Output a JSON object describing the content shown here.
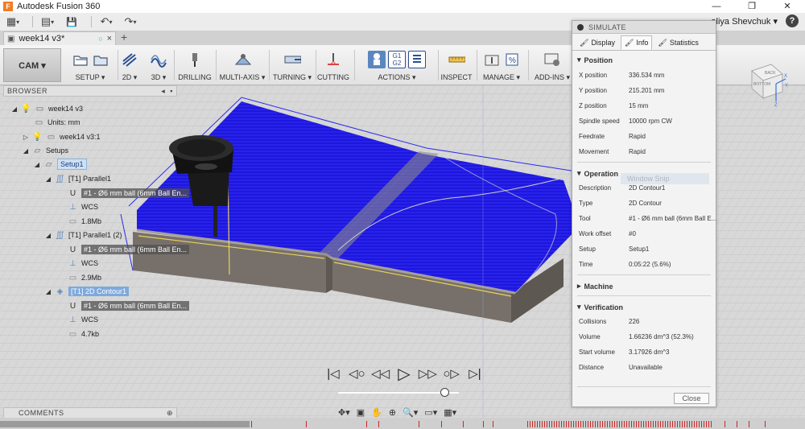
{
  "window": {
    "title": "Autodesk Fusion 360",
    "logo_letter": "F",
    "minimize": "—",
    "restore": "❐",
    "close": "✕"
  },
  "quickbar": {
    "grid_glyph": "▦",
    "grid_caret": "▾",
    "file_glyph": "▤",
    "file_caret": "▾",
    "save_glyph": "💾",
    "undo_glyph": "↶",
    "undo_caret": "▾",
    "redo_glyph": "↷",
    "redo_caret": "▾",
    "user": "aliya Shevchuk ▾",
    "help": "?"
  },
  "tabs": {
    "doc_tab_label": "week14 v3*",
    "doc_tab_icon": "▣",
    "doc_tab_dot": "○",
    "doc_tab_close": "×",
    "add_tab": "+"
  },
  "ribbon": {
    "workspace_label": "CAM ▾",
    "groups": [
      {
        "label": "SETUP ▾"
      },
      {
        "label": "2D ▾"
      },
      {
        "label": "3D ▾"
      },
      {
        "label": "DRILLING"
      },
      {
        "label": "MULTI-AXIS ▾"
      },
      {
        "label": "TURNING ▾"
      },
      {
        "label": "CUTTING"
      },
      {
        "label": "ACTIONS ▾"
      },
      {
        "label": "INSPECT"
      },
      {
        "label": "MANAGE ▾"
      },
      {
        "label": "ADD-INS ▾"
      }
    ],
    "actions_g1": "G1",
    "actions_g2": "G2"
  },
  "browser": {
    "header": "BROWSER",
    "collapse": "◂",
    "pin": "▪",
    "tree": [
      {
        "label": "week14 v3"
      },
      {
        "label": "Units: mm"
      },
      {
        "label": "week14 v3:1"
      },
      {
        "label": "Setups"
      },
      {
        "label": "Setup1"
      },
      {
        "label": "[T1] Parallel1"
      },
      {
        "label": "#1 - Ø6 mm ball (6mm Ball En..."
      },
      {
        "label": "WCS"
      },
      {
        "label": "1.8Mb"
      },
      {
        "label": "[T1] Parallel1 (2)"
      },
      {
        "label": "#1 - Ø6 mm ball (6mm Ball En..."
      },
      {
        "label": "WCS"
      },
      {
        "label": "2.9Mb"
      },
      {
        "label": "[T1] 2D Contour1"
      },
      {
        "label": "#1 - Ø6 mm ball (6mm Ball En..."
      },
      {
        "label": "WCS"
      },
      {
        "label": "4.7kb"
      }
    ]
  },
  "comments": {
    "label": "COMMENTS",
    "add": "⊕"
  },
  "simulate": {
    "title": "SIMULATE",
    "tabs": [
      {
        "label": "Display"
      },
      {
        "label": "Info"
      },
      {
        "label": "Statistics"
      }
    ],
    "position": {
      "heading": "Position",
      "rows": [
        {
          "key": "X position",
          "value": "336.534 mm"
        },
        {
          "key": "Y position",
          "value": "215.201 mm"
        },
        {
          "key": "Z position",
          "value": "15 mm"
        },
        {
          "key": "Spindle speed",
          "value": "10000 rpm CW"
        },
        {
          "key": "Feedrate",
          "value": "Rapid"
        },
        {
          "key": "Movement",
          "value": "Rapid"
        }
      ]
    },
    "operation": {
      "heading": "Operation",
      "ghost": "Window Snip",
      "rows": [
        {
          "key": "Description",
          "value": "2D Contour1"
        },
        {
          "key": "Type",
          "value": "2D Contour"
        },
        {
          "key": "Tool",
          "value": "#1 - Ø6 mm ball (6mm Ball E..."
        },
        {
          "key": "Work offset",
          "value": "#0"
        },
        {
          "key": "Setup",
          "value": "Setup1"
        },
        {
          "key": "Time",
          "value": "0:05:22 (5.6%)"
        }
      ]
    },
    "machine": {
      "heading": "Machine"
    },
    "verification": {
      "heading": "Verification",
      "rows": [
        {
          "key": "Collisions",
          "value": "226"
        },
        {
          "key": "Volume",
          "value": "1.66236 dm^3 (52.3%)"
        },
        {
          "key": "Start volume",
          "value": "3.17926 dm^3"
        },
        {
          "key": "Distance",
          "value": "Unavailable"
        }
      ]
    },
    "close_label": "Close"
  },
  "playback": {
    "to_start": "|◁",
    "prev_op": "◁○",
    "step_back": "◁◁",
    "play": "▷",
    "step_fwd": "▷▷",
    "next_op": "○▷",
    "to_end": "▷|",
    "progress_fraction": 0.88
  },
  "navbar": {
    "orbit": "✥▾",
    "look": "▣",
    "pan": "✋",
    "zoom_window": "⊕",
    "zoom": "🔍▾",
    "display": "▭▾",
    "grid": "▦▾"
  },
  "viewcube": {
    "back": "BACK",
    "bottom": "BOTTOM",
    "x": "X",
    "y": "Y",
    "z": "Z"
  },
  "colors": {
    "toolpath_blue": "#1d16e0",
    "stock_gray": "#77706a",
    "ribbon_active": "#5b87c1",
    "tree_selected": "#7ea9dc"
  }
}
